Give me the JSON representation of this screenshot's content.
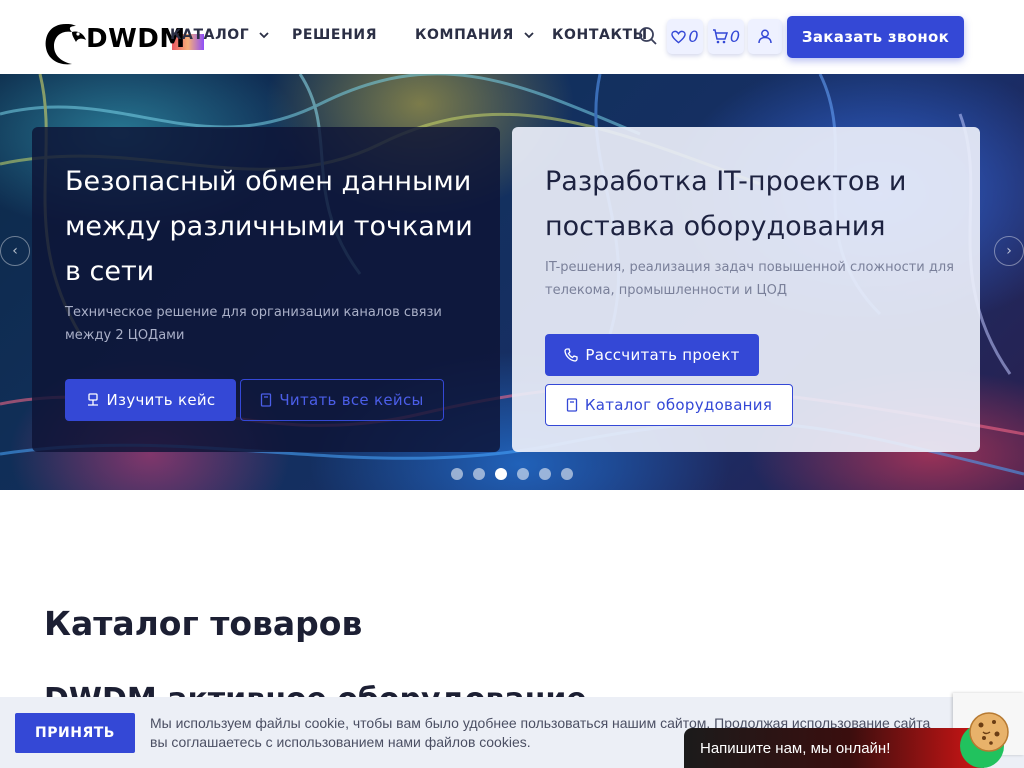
{
  "header": {
    "logo_text": "DWDM",
    "nav": [
      {
        "label": "КАТАЛОГ",
        "has_dropdown": true
      },
      {
        "label": "РЕШЕНИЯ",
        "has_dropdown": false
      },
      {
        "label": "КОМПАНИЯ",
        "has_dropdown": true
      },
      {
        "label": "КОНТАКТЫ",
        "has_dropdown": false
      }
    ],
    "favorites_count": "0",
    "cart_count": "0",
    "cta_label": "Заказать звонок",
    "icons": [
      "search-icon",
      "heart-icon",
      "cart-icon",
      "user-icon"
    ]
  },
  "hero": {
    "slides": [
      {
        "title": "Безопасный обмен данными между различными точками в сети",
        "subtitle": "Техническое решение для организации каналов связи между 2 ЦОДами",
        "primary_button": "Изучить кейс",
        "secondary_button": "Читать все кейсы"
      },
      {
        "title": "Разработка IT-проектов и поставка оборудования",
        "subtitle": "IT-решения, реализация задач повышенной сложности для телекома, промышленности и ЦОД",
        "primary_button": "Рассчитать проект",
        "secondary_button": "Каталог оборудования"
      }
    ],
    "dots_total": 6,
    "active_dot": 3
  },
  "content": {
    "section_title": "Каталог товаров",
    "subsection_title": "DWDM активное оборудование"
  },
  "cookie": {
    "accept_label": "ПРИНЯТЬ",
    "text": "Мы используем файлы cookie, чтобы вам было удобнее пользоваться нашим сайтом. Продолжая использование сайта вы соглашаетесь с использованием нами файлов cookies."
  },
  "chat": {
    "label": "Напишите нам, мы онлайн!"
  },
  "colors": {
    "accent": "#3448d6",
    "dark_card": "#0e1436",
    "light_card": "#eceffa"
  }
}
